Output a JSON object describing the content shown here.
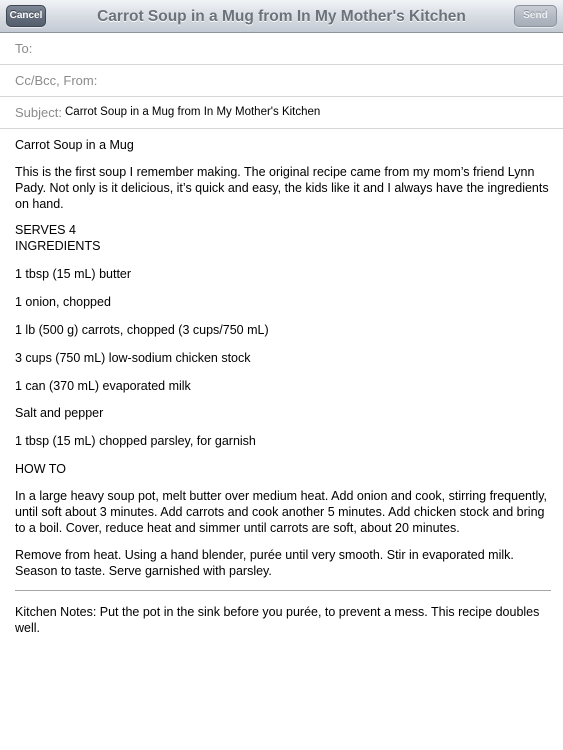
{
  "navbar": {
    "title": "Carrot Soup in a Mug from In My Mother's Kitchen",
    "cancel_label": "Cancel",
    "send_label": "Send"
  },
  "fields": {
    "to_label": "To:",
    "cc_label": "Cc/Bcc, From:",
    "subject_label": "Subject:",
    "subject_value": "Carrot Soup in a Mug from In My Mother's Kitchen"
  },
  "body": {
    "heading": "Carrot Soup in a Mug",
    "intro": "This is the first soup I remember making. The original recipe came from my mom’s friend Lynn Pady. Not only is it delicious, it’s quick and easy, the kids like it and I always have the ingredients on hand.",
    "serves": "SERVES 4",
    "ingredients_title": "INGREDIENTS",
    "ingredients": [
      "1 tbsp (15 mL) butter",
      "1 onion, chopped",
      "1 lb (500 g) carrots, chopped (3 cups/750 mL)",
      "3 cups (750 mL) low-sodium chicken stock",
      "1 can (370 mL) evaporated milk",
      "Salt and pepper",
      "1 tbsp (15 mL) chopped parsley, for garnish"
    ],
    "howto_title": "HOW TO",
    "steps": [
      "In a large heavy soup pot, melt butter over medium heat. Add onion and cook, stirring frequently, until soft about 3 minutes. Add carrots and cook another 5 minutes. Add chicken stock and bring to a boil. Cover, reduce heat and simmer until carrots are soft, about 20 minutes.",
      "Remove from heat. Using a hand blender, purée until very smooth. Stir in evaporated milk. Season to taste. Serve garnished with parsley."
    ],
    "notes": "Kitchen Notes: Put the pot in the sink before you purée, to prevent a mess. This recipe doubles well."
  }
}
